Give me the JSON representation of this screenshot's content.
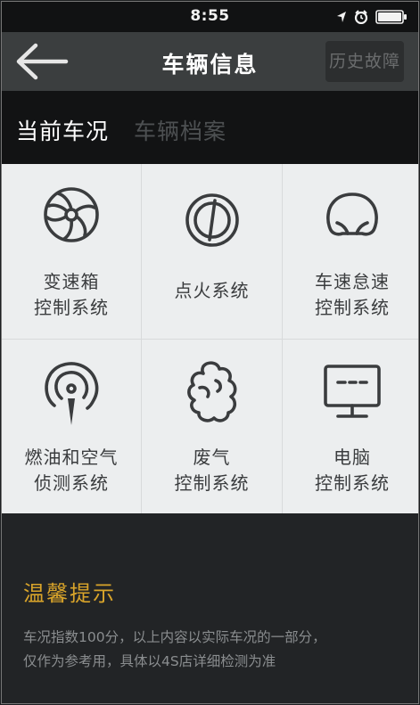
{
  "status_bar": {
    "time": "8:55",
    "icons": [
      "location-arrow-icon",
      "alarm-icon",
      "battery-icon"
    ]
  },
  "nav": {
    "back_icon": "arrow-left-icon",
    "title": "车辆信息",
    "history_label": "历史故障"
  },
  "tabs": [
    {
      "label": "当前车况",
      "active": true
    },
    {
      "label": "车辆档案",
      "active": false
    }
  ],
  "systems": [
    {
      "icon": "turbine-icon",
      "line1": "变速箱",
      "line2": "控制系统"
    },
    {
      "icon": "ignition-icon",
      "line1": "点火系统",
      "line2": ""
    },
    {
      "icon": "car-seat-icon",
      "line1": "车速怠速",
      "line2": "控制系统"
    },
    {
      "icon": "fuel-sensor-icon",
      "line1": "燃油和空气",
      "line2": "侦测系统"
    },
    {
      "icon": "exhaust-cloud-icon",
      "line1": "废气",
      "line2": "控制系统"
    },
    {
      "icon": "computer-monitor-icon",
      "line1": "电脑",
      "line2": "控制系统"
    }
  ],
  "tips": {
    "title": "温馨提示",
    "line1": "车况指数100分，以上内容以实际车况的一部分，",
    "line2": "仅作为参考用，具体以4S店详细检测为准"
  },
  "colors": {
    "accent": "#d9a42a",
    "nav_background": "#3b3e3f",
    "tab_background": "#121314",
    "grid_background": "#eceeef"
  }
}
